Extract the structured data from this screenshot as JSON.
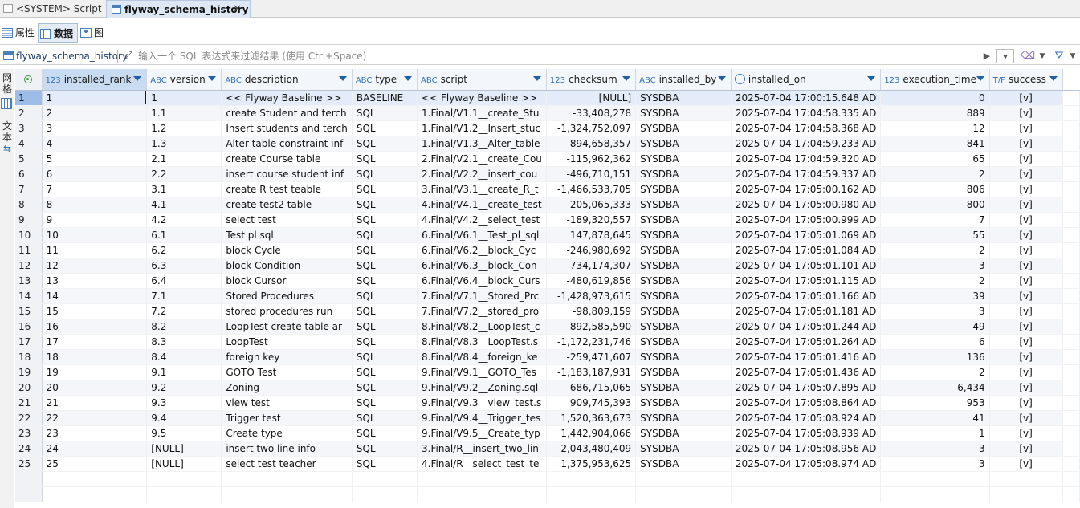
{
  "editor_tabs": {
    "system_script": "<SYSTEM> Script",
    "active": "flyway_schema_history"
  },
  "view_tabs": {
    "properties": "属性",
    "data": "数据",
    "diagram": "图"
  },
  "filter_bar": {
    "table_name": "flyway_schema_history",
    "placeholder": "输入一个 SQL 表达式来过滤结果 (使用 Ctrl+Space)"
  },
  "side_bar": {
    "grid_label": "网格",
    "text_label": "文本"
  },
  "columns": [
    {
      "type": "123",
      "name": "installed_rank",
      "sorted": true
    },
    {
      "type": "ABC",
      "name": "version"
    },
    {
      "type": "ABC",
      "name": "description"
    },
    {
      "type": "ABC",
      "name": "type"
    },
    {
      "type": "ABC",
      "name": "script"
    },
    {
      "type": "123",
      "name": "checksum"
    },
    {
      "type": "ABC",
      "name": "installed_by"
    },
    {
      "type": "clock",
      "name": "installed_on"
    },
    {
      "type": "123",
      "name": "execution_time"
    },
    {
      "type": "T/F",
      "name": "success"
    }
  ],
  "rows": [
    [
      "1",
      "1",
      "1",
      "<< Flyway Baseline >>",
      "BASELINE",
      "<< Flyway Baseline >>",
      "[NULL]",
      "SYSDBA",
      "2025-07-04 17:00:15.648 AD",
      "0",
      "[v]"
    ],
    [
      "2",
      "2",
      "1.1",
      "create Student and terch",
      "SQL",
      "1.Final/V1.1__create_Stu",
      "-33,408,278",
      "SYSDBA",
      "2025-07-04 17:04:58.335 AD",
      "889",
      "[v]"
    ],
    [
      "3",
      "3",
      "1.2",
      "Insert students and terch",
      "SQL",
      "1.Final/V1.2__Insert_stuc",
      "-1,324,752,097",
      "SYSDBA",
      "2025-07-04 17:04:58.368 AD",
      "12",
      "[v]"
    ],
    [
      "4",
      "4",
      "1.3",
      "Alter table constraint inf",
      "SQL",
      "1.Final/V1.3__Alter_table",
      "894,658,357",
      "SYSDBA",
      "2025-07-04 17:04:59.233 AD",
      "841",
      "[v]"
    ],
    [
      "5",
      "5",
      "2.1",
      "create Course table",
      "SQL",
      "2.Final/V2.1__create_Cou",
      "-115,962,362",
      "SYSDBA",
      "2025-07-04 17:04:59.320 AD",
      "65",
      "[v]"
    ],
    [
      "6",
      "6",
      "2.2",
      "insert course student inf",
      "SQL",
      "2.Final/V2.2__insert_cou",
      "-496,710,151",
      "SYSDBA",
      "2025-07-04 17:04:59.337 AD",
      "2",
      "[v]"
    ],
    [
      "7",
      "7",
      "3.1",
      "create R test teable",
      "SQL",
      "3.Final/V3.1__create_R_t",
      "-1,466,533,705",
      "SYSDBA",
      "2025-07-04 17:05:00.162 AD",
      "806",
      "[v]"
    ],
    [
      "8",
      "8",
      "4.1",
      "create test2 table",
      "SQL",
      "4.Final/V4.1__create_test",
      "-205,065,333",
      "SYSDBA",
      "2025-07-04 17:05:00.980 AD",
      "800",
      "[v]"
    ],
    [
      "9",
      "9",
      "4.2",
      "select test",
      "SQL",
      "4.Final/V4.2__select_test",
      "-189,320,557",
      "SYSDBA",
      "2025-07-04 17:05:00.999 AD",
      "7",
      "[v]"
    ],
    [
      "10",
      "10",
      "6.1",
      "Test pl sql",
      "SQL",
      "6.Final/V6.1__Test_pl_sql",
      "147,878,645",
      "SYSDBA",
      "2025-07-04 17:05:01.069 AD",
      "55",
      "[v]"
    ],
    [
      "11",
      "11",
      "6.2",
      "block Cycle",
      "SQL",
      "6.Final/V6.2__block_Cyc",
      "-246,980,692",
      "SYSDBA",
      "2025-07-04 17:05:01.084 AD",
      "2",
      "[v]"
    ],
    [
      "12",
      "12",
      "6.3",
      "block Condition",
      "SQL",
      "6.Final/V6.3__block_Con",
      "734,174,307",
      "SYSDBA",
      "2025-07-04 17:05:01.101 AD",
      "3",
      "[v]"
    ],
    [
      "13",
      "13",
      "6.4",
      "block Cursor",
      "SQL",
      "6.Final/V6.4__block_Curs",
      "-480,619,856",
      "SYSDBA",
      "2025-07-04 17:05:01.115 AD",
      "2",
      "[v]"
    ],
    [
      "14",
      "14",
      "7.1",
      "Stored Procedures",
      "SQL",
      "7.Final/V7.1__Stored_Prc",
      "-1,428,973,615",
      "SYSDBA",
      "2025-07-04 17:05:01.166 AD",
      "39",
      "[v]"
    ],
    [
      "15",
      "15",
      "7.2",
      "stored procedures run",
      "SQL",
      "7.Final/V7.2__stored_pro",
      "-98,809,159",
      "SYSDBA",
      "2025-07-04 17:05:01.181 AD",
      "3",
      "[v]"
    ],
    [
      "16",
      "16",
      "8.2",
      "LoopTest create table ar",
      "SQL",
      "8.Final/V8.2__LoopTest_c",
      "-892,585,590",
      "SYSDBA",
      "2025-07-04 17:05:01.244 AD",
      "49",
      "[v]"
    ],
    [
      "17",
      "17",
      "8.3",
      "LoopTest",
      "SQL",
      "8.Final/V8.3__LoopTest.s",
      "-1,172,231,746",
      "SYSDBA",
      "2025-07-04 17:05:01.264 AD",
      "6",
      "[v]"
    ],
    [
      "18",
      "18",
      "8.4",
      "foreign key",
      "SQL",
      "8.Final/V8.4__foreign_ke",
      "-259,471,607",
      "SYSDBA",
      "2025-07-04 17:05:01.416 AD",
      "136",
      "[v]"
    ],
    [
      "19",
      "19",
      "9.1",
      "GOTO Test",
      "SQL",
      "9.Final/V9.1__GOTO_Tes",
      "-1,183,187,931",
      "SYSDBA",
      "2025-07-04 17:05:01.436 AD",
      "2",
      "[v]"
    ],
    [
      "20",
      "20",
      "9.2",
      "Zoning",
      "SQL",
      "9.Final/V9.2__Zoning.sql",
      "-686,715,065",
      "SYSDBA",
      "2025-07-04 17:05:07.895 AD",
      "6,434",
      "[v]"
    ],
    [
      "21",
      "21",
      "9.3",
      "view test",
      "SQL",
      "9.Final/V9.3__view_test.s",
      "909,745,393",
      "SYSDBA",
      "2025-07-04 17:05:08.864 AD",
      "953",
      "[v]"
    ],
    [
      "22",
      "22",
      "9.4",
      "Trigger test",
      "SQL",
      "9.Final/V9.4__Trigger_tes",
      "1,520,363,673",
      "SYSDBA",
      "2025-07-04 17:05:08.924 AD",
      "41",
      "[v]"
    ],
    [
      "23",
      "23",
      "9.5",
      "Create type",
      "SQL",
      "9.Final/V9.5__Create_typ",
      "1,442,904,066",
      "SYSDBA",
      "2025-07-04 17:05:08.939 AD",
      "1",
      "[v]"
    ],
    [
      "24",
      "24",
      "[NULL]",
      "insert two line info",
      "SQL",
      "3.Final/R__insert_two_lin",
      "2,043,480,409",
      "SYSDBA",
      "2025-07-04 17:05:08.956 AD",
      "3",
      "[v]"
    ],
    [
      "25",
      "25",
      "[NULL]",
      "select test teacher",
      "SQL",
      "4.Final/R__select_test_te",
      "1,375,953,625",
      "SYSDBA",
      "2025-07-04 17:05:08.974 AD",
      "3",
      "[v]"
    ]
  ],
  "colors": {
    "accent": "#2f6fb2",
    "selected_header": "#c9dbf1",
    "selected_row_number": "#9cbde8",
    "null_text": "#9a9a9a"
  }
}
